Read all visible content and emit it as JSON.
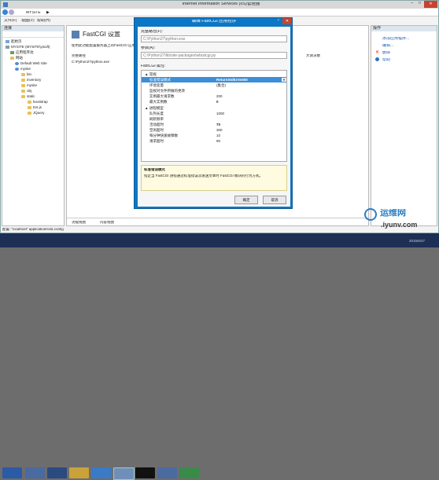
{
  "window": {
    "title": "Internet Information Services (IIS)管理器",
    "min": "–",
    "max": "□",
    "close": "✕"
  },
  "address": {
    "crumbs": [
      "MYSITE",
      "▶"
    ]
  },
  "menubar": {
    "items": [
      "文件(F)",
      "视图(V)",
      "帮助(H)"
    ]
  },
  "connections": {
    "title": "连接",
    "tree": [
      {
        "label": "起始页"
      },
      {
        "label": "MYSITE (MYSITE\\yisoft)"
      },
      {
        "label": "应用程序池"
      },
      {
        "label": "网站"
      },
      {
        "label": "Default Web Site"
      },
      {
        "label": "mysite"
      },
      {
        "label": "bin"
      },
      {
        "label": "inventory"
      },
      {
        "label": "mysite"
      },
      {
        "label": "obj"
      },
      {
        "label": "static"
      },
      {
        "label": "bootstrap"
      },
      {
        "label": "Ext.js"
      },
      {
        "label": "JQuery"
      }
    ]
  },
  "center": {
    "title": "FastCGI 设置",
    "desc": "使用此功能配置服务器上的FastCGI 应用",
    "col_path": "完整路径",
    "col_args": "大请求数",
    "row_path": "C:\\Python27\\python.exe",
    "tabs": [
      "功能视图",
      "内容视图"
    ]
  },
  "actions": {
    "title": "操作",
    "items": [
      "添加应用程序...",
      "编辑...",
      "删除",
      "帮助"
    ]
  },
  "status": {
    "text": "配置: \"localhost\" applicationHost.config"
  },
  "dialog": {
    "title": "编辑 FastCGI 应用程序",
    "help": "?",
    "close": "✕",
    "path_label": "完整路径(F):",
    "path_value": "C:\\Python27\\python.exe",
    "args_label": "参数(A):",
    "args_value": "C:\\Python27\\lib\\site-packages\\wfastcgi.py",
    "props_label": "FastCGI 属性:",
    "groups": [
      {
        "name": "常规",
        "rows": [
          {
            "k": "标准错误模式",
            "v": "ReturnStdErrIn500"
          },
          {
            "k": "环境变量",
            "v": "(集合)"
          },
          {
            "k": "监视对文件所做的更改",
            "v": ""
          },
          {
            "k": "实例最大请求数",
            "v": "200"
          },
          {
            "k": "最大实例数",
            "v": "0"
          }
        ]
      },
      {
        "name": "进程模型",
        "rows": [
          {
            "k": "队列长度",
            "v": "1000"
          },
          {
            "k": "刷新频率",
            "v": ""
          },
          {
            "k": "活动超时",
            "v": "70"
          },
          {
            "k": "空闲超时",
            "v": "300"
          },
          {
            "k": "每分钟快速故障数",
            "v": "10"
          },
          {
            "k": "请求超时",
            "v": "90"
          }
        ]
      }
    ],
    "desc_title": "标准错误模式",
    "desc_text": "指定当 FastCGI 进程通过标准错误流发送文本时 FastCGI 模块的行为方式。",
    "ok": "确定",
    "cancel": "取消"
  },
  "watermark": {
    "brand": "运维网",
    "url": ".iyunv.com"
  },
  "taskbar": {
    "time": "2015/6/27"
  }
}
